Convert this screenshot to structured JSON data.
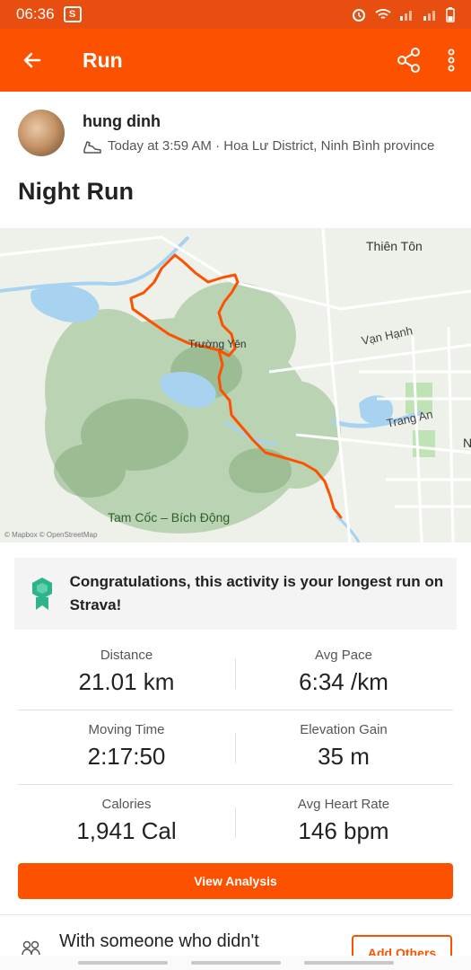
{
  "status_bar": {
    "time": "06:36",
    "badge": "S"
  },
  "header": {
    "title": "Run"
  },
  "athlete": {
    "name": "hung dinh",
    "meta": "Today at 3:59 AM · Hoa Lư District, Ninh Bình province"
  },
  "activity": {
    "title": "Night Run"
  },
  "map": {
    "labels": {
      "thien_ton": "Thiên Tôn",
      "van_hanh": "Vạn Hạnh",
      "truong_yen": "Trường Yên",
      "trang_an": "Trang An",
      "tam_coc": "Tam Cốc – Bích Động",
      "edge_letter": "N",
      "attribution": "© Mapbox © OpenStreetMap"
    },
    "colors": {
      "route": "#fc5200",
      "water": "#a8d3f0",
      "land": "#eef1ea",
      "hills": "#a9c9a0",
      "park": "#bfe3b4"
    }
  },
  "achievement": {
    "text": "Congratulations, this activity is your longest run on Strava!"
  },
  "stats": [
    {
      "label": "Distance",
      "value": "21.01 km"
    },
    {
      "label": "Avg Pace",
      "value": "6:34 /km"
    },
    {
      "label": "Moving Time",
      "value": "2:17:50"
    },
    {
      "label": "Elevation Gain",
      "value": "35 m"
    },
    {
      "label": "Calories",
      "value": "1,941 Cal"
    },
    {
      "label": "Avg Heart Rate",
      "value": "146 bpm"
    }
  ],
  "actions": {
    "view_analysis": "View Analysis",
    "add_others": "Add Others"
  },
  "with_others": {
    "text": "With someone who didn't"
  },
  "colors": {
    "brand": "#fc5200",
    "status_bar": "#e84e0f"
  }
}
